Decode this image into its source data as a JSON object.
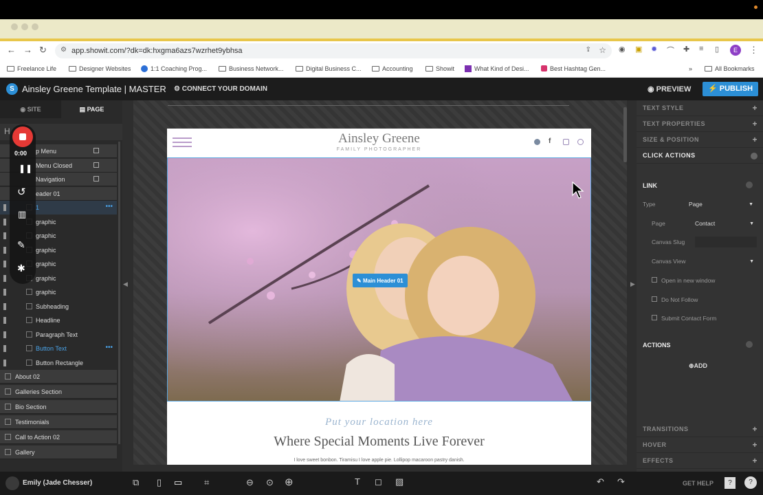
{
  "browser": {
    "url": "app.showit.com/?dk=dk:hxgma6azs7wzrhet9ybhsa",
    "profile_initial": "E",
    "bookmarks": [
      "Freelance Life",
      "Designer Websites",
      "1:1 Coaching Prog...",
      "Business Network...",
      "Digital Business C...",
      "Accounting",
      "Showit",
      "What Kind of Desi...",
      "Best Hashtag Gen..."
    ],
    "all_bookmarks": "All Bookmarks"
  },
  "app": {
    "title": "Ainsley Greene Template | MASTER",
    "connect_domain": "CONNECT YOUR DOMAIN",
    "preview": "PREVIEW",
    "publish": "PUBLISH",
    "accent": "#2c8fd6"
  },
  "sidebar": {
    "tab_site": "SITE",
    "tab_page": "PAGE",
    "layers": [
      {
        "label": "p Menu",
        "type": "section"
      },
      {
        "label": "Menu Closed",
        "type": "section"
      },
      {
        "label": "Navigation",
        "type": "section"
      },
      {
        "label": "eader 01",
        "type": "section"
      },
      {
        "label": "1",
        "type": "active"
      },
      {
        "label": "graphic",
        "type": "item"
      },
      {
        "label": "graphic",
        "type": "item"
      },
      {
        "label": "graphic",
        "type": "item"
      },
      {
        "label": "graphic",
        "type": "item"
      },
      {
        "label": "graphic",
        "type": "item"
      },
      {
        "label": "graphic",
        "type": "item"
      },
      {
        "label": "Subheading",
        "type": "item"
      },
      {
        "label": "Headline",
        "type": "item"
      },
      {
        "label": "Paragraph Text",
        "type": "item"
      },
      {
        "label": "Button Text",
        "type": "selected"
      },
      {
        "label": "Button Rectangle",
        "type": "item"
      }
    ],
    "sections": [
      "About 02",
      "Galleries Section",
      "Bio Section",
      "Testimonials",
      "Call to Action 02",
      "Gallery"
    ]
  },
  "recorder": {
    "time": "0:00"
  },
  "site": {
    "brand": "Ainsley Greene",
    "tagline": "FAMILY PHOTOGRAPHER",
    "badge": "Main Header 01",
    "location": "Put your location here",
    "headline": "Where Special Moments Live Forever",
    "paragraph": "I love sweet bonbon. Tiramisu I love apple pie. Lollipop macaroon pastry danish."
  },
  "rpanel": {
    "text_style": "TEXT STYLE",
    "text_properties": "TEXT PROPERTIES",
    "size_position": "SIZE & POSITION",
    "click_actions": "CLICK ACTIONS",
    "link": "LINK",
    "type_label": "Type",
    "type_value": "Page",
    "page_label": "Page",
    "page_value": "Contact",
    "canvas_slug": "Canvas Slug",
    "canvas_view": "Canvas View",
    "open_new": "Open in new window",
    "no_follow": "Do Not Follow",
    "submit_form": "Submit Contact Form",
    "actions": "ACTIONS",
    "add": "ADD",
    "transitions": "TRANSITIONS",
    "hover": "HOVER",
    "effects": "EFFECTS"
  },
  "bottom": {
    "user": "Emily (Jade Chesser)",
    "help": "GET HELP"
  }
}
